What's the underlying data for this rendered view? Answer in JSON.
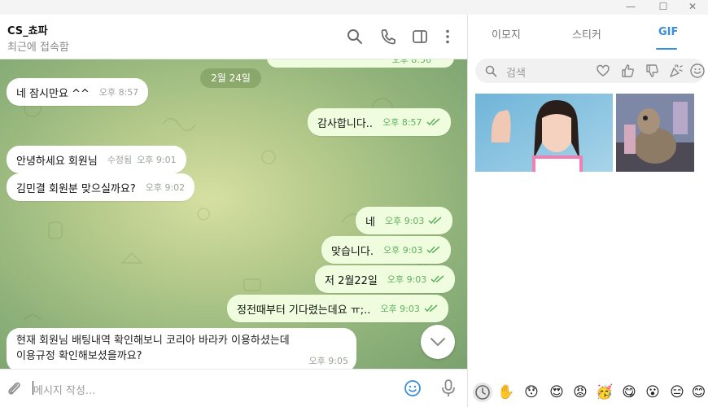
{
  "window": {
    "minimize_glyph": "—",
    "maximize_glyph": "☐",
    "close_glyph": "✕"
  },
  "chat": {
    "title": "CS_쵸파",
    "status": "최근에 접속함",
    "date_pill": "2월 24일",
    "partial_top_time": "오후 8:56"
  },
  "messages": [
    {
      "dir": "in",
      "text": "네 잠시만요 ^^",
      "time": "오후 8:57"
    },
    {
      "dir": "out",
      "text": "감사합니다..",
      "time": "오후 8:57"
    },
    {
      "dir": "in",
      "text": "안녕하세요 회원님",
      "edited": "수정됨",
      "time": "오후 9:01"
    },
    {
      "dir": "in",
      "text": "김민결 회원분 맞으실까요?",
      "time": "오후 9:02"
    },
    {
      "dir": "out",
      "text": "네",
      "time": "오후 9:03"
    },
    {
      "dir": "out",
      "text": "맞습니다.",
      "time": "오후 9:03"
    },
    {
      "dir": "out",
      "text": "저 2월22일",
      "time": "오후 9:03"
    },
    {
      "dir": "out",
      "text": "정전때부터 기다렸는데요 ㅠ;..",
      "time": "오후 9:03"
    },
    {
      "dir": "in",
      "line1": "현재 회원님 배팅내역 확인해보니 코리아 바라카 이용하셨는데",
      "line2": "이용규정 확인해보셨을까요?",
      "time": "오후 9:05"
    }
  ],
  "input": {
    "placeholder": "메시지 작성..."
  },
  "panel": {
    "tabs": [
      "이모지",
      "스티커",
      "GIF"
    ],
    "active_tab": "GIF",
    "search_placeholder": "검색",
    "accent_color": "#3a8fdc"
  },
  "emoji_bar": [
    "clock-icon",
    "✋",
    "😯",
    "😍",
    "😡",
    "🥳",
    "😋",
    "😮",
    "😑",
    "😊"
  ],
  "colors": {
    "outgoing_bubble": "#effdde",
    "incoming_bubble": "#ffffff",
    "read_check": "#5db15e"
  }
}
